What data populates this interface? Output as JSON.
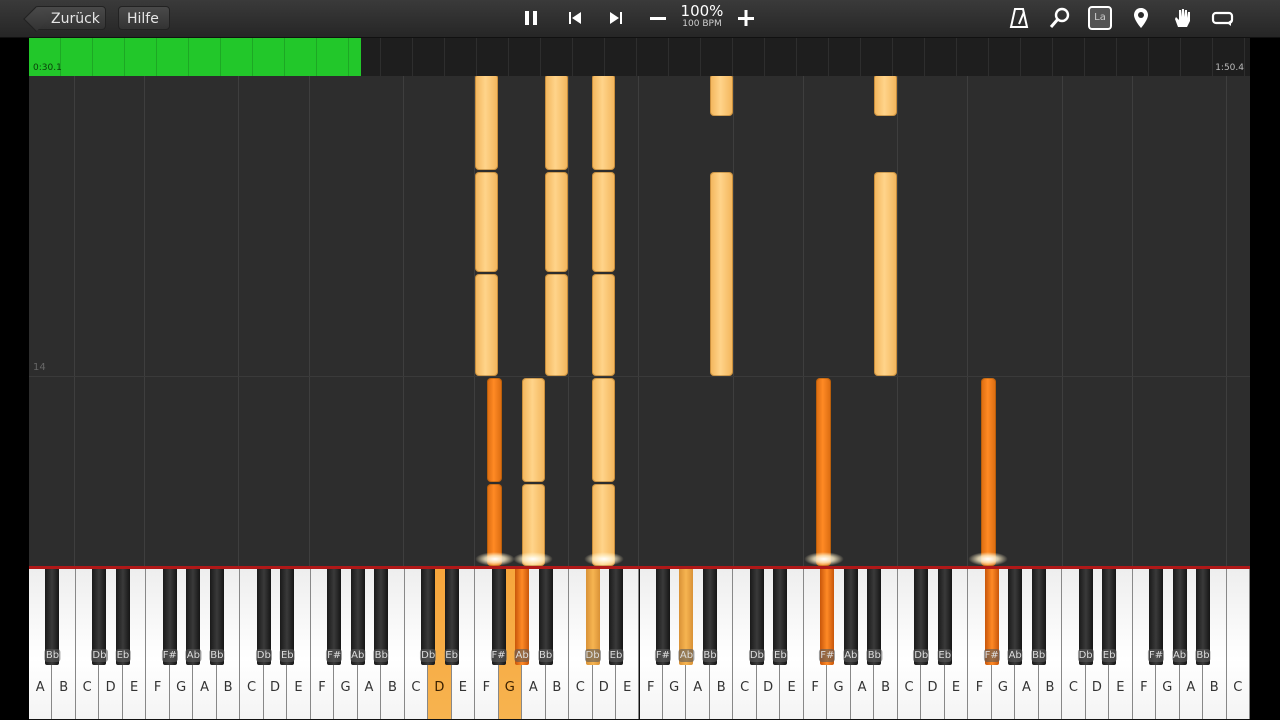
{
  "toolbar": {
    "back_label": "Zurück",
    "help_label": "Hilfe",
    "speed_percent": "100%",
    "speed_bpm": "100 BPM",
    "icons": [
      "pause-icon",
      "skip-back-icon",
      "skip-forward-icon",
      "minus-icon",
      "plus-icon",
      "metronome-icon",
      "magnifier-icon",
      "label-icon",
      "location-pin-icon",
      "hand-icon",
      "loop-icon"
    ],
    "label_icon_text": "La"
  },
  "progress": {
    "elapsed": "0:30.1",
    "total": "1:50.4",
    "fraction": 0.272,
    "fill_color": "#22c72a"
  },
  "roll": {
    "measure_number": "14"
  },
  "keyboard": {
    "white_keys": [
      "A",
      "B",
      "C",
      "D",
      "E",
      "F",
      "G",
      "A",
      "B",
      "C",
      "D",
      "E",
      "F",
      "G",
      "A",
      "B",
      "C",
      "D",
      "E",
      "F",
      "G",
      "A",
      "B",
      "C",
      "D",
      "E",
      "F",
      "G",
      "A",
      "B",
      "C",
      "D",
      "E",
      "F",
      "G",
      "A",
      "B",
      "C",
      "D",
      "E",
      "F",
      "G",
      "A",
      "B",
      "C",
      "D",
      "E",
      "F",
      "G",
      "A",
      "B",
      "C"
    ],
    "black_keys": [
      "Bb",
      "Db",
      "Eb",
      "F#",
      "Ab",
      "Bb",
      "Db",
      "Eb",
      "F#",
      "Ab",
      "Bb",
      "Db",
      "Eb",
      "F#",
      "Ab",
      "Bb",
      "Db",
      "Eb",
      "F#",
      "Ab",
      "Bb",
      "Db",
      "Eb",
      "F#",
      "Ab",
      "Bb",
      "Db",
      "Eb",
      "F#",
      "Ab",
      "Bb",
      "Db",
      "Eb",
      "F#",
      "Ab",
      "Bb"
    ],
    "active_white": [
      17,
      20
    ],
    "active_black": [
      {
        "i": 14,
        "tone": "dark"
      },
      {
        "i": 16,
        "tone": "light"
      },
      {
        "i": 19,
        "tone": "light"
      },
      {
        "i": 23,
        "tone": "dark"
      },
      {
        "i": 28,
        "tone": "dark"
      }
    ],
    "colors": {
      "active_dark": "#ff8a24",
      "active_light": "#f6b451",
      "red_line": "#b01818"
    }
  }
}
